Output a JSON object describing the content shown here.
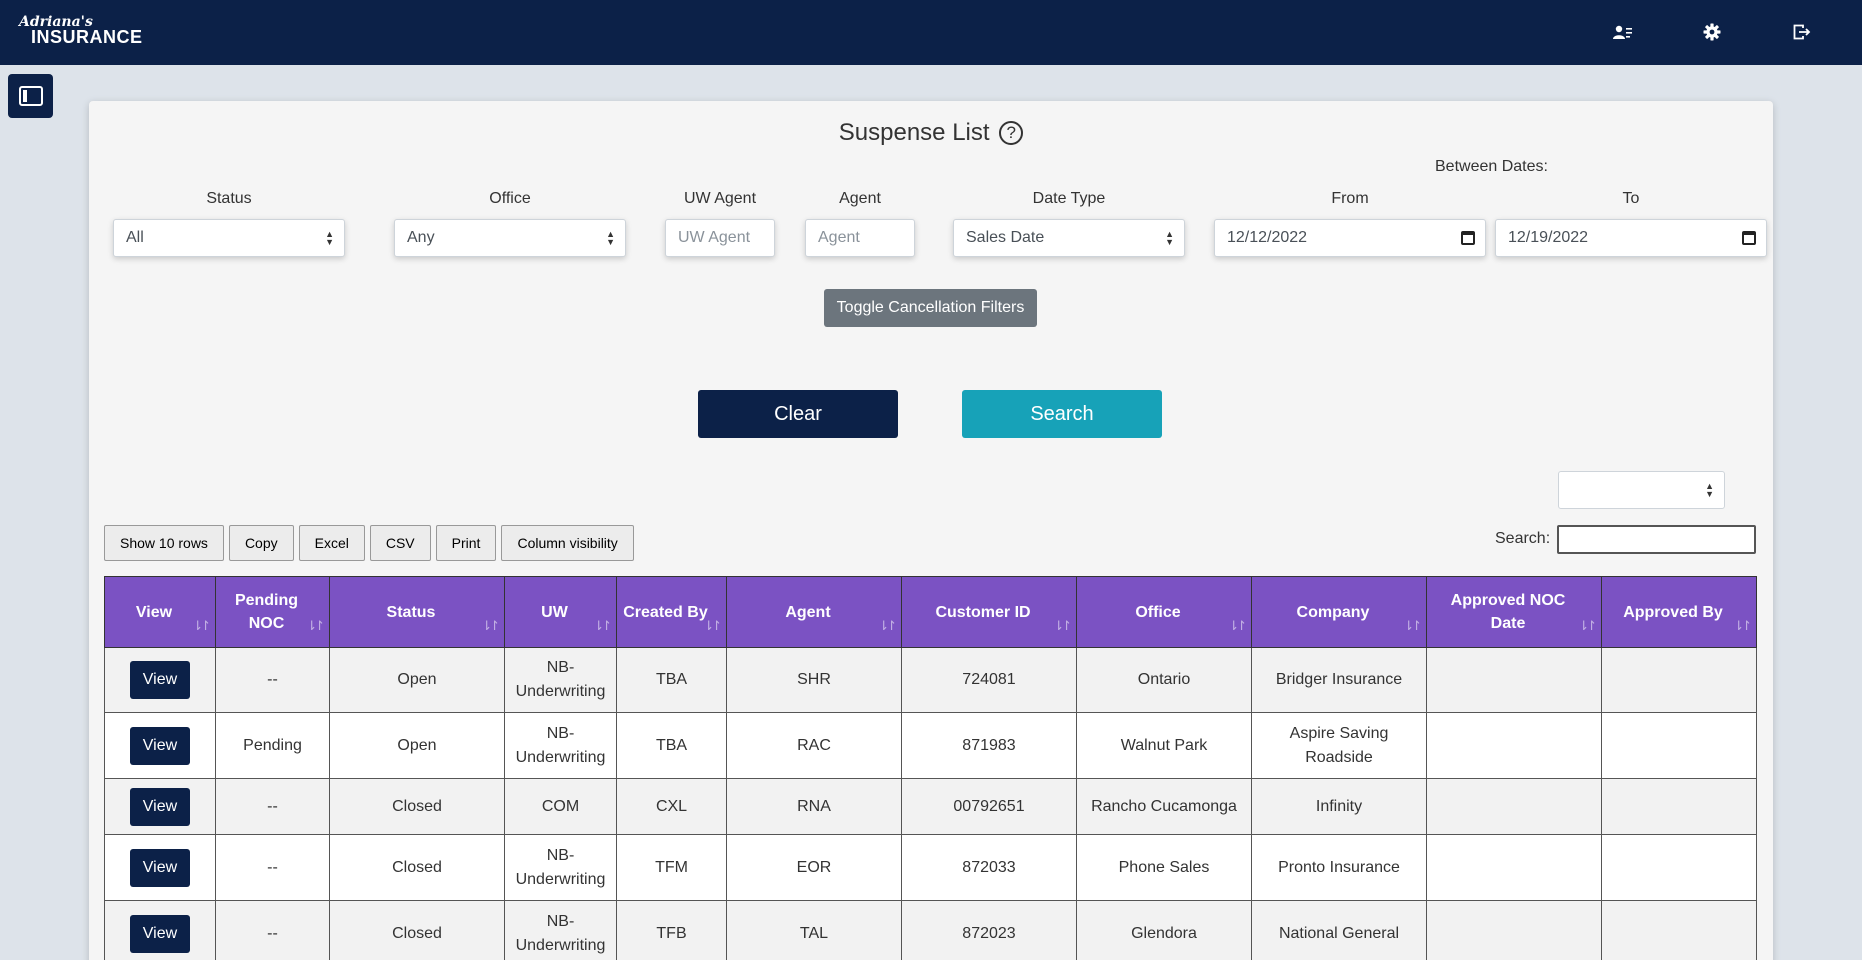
{
  "navbar": {
    "logo_script": "Adriana's",
    "logo_main": "INSURANCE",
    "icons": [
      "user-list-icon",
      "gear-icon",
      "logout-icon"
    ]
  },
  "page": {
    "title": "Suspense List",
    "help_glyph": "?",
    "between_dates_label": "Between Dates:"
  },
  "filters": {
    "status": {
      "label": "Status",
      "value": "All"
    },
    "office": {
      "label": "Office",
      "value": "Any"
    },
    "uw_agent": {
      "label": "UW Agent",
      "placeholder": "UW Agent"
    },
    "agent": {
      "label": "Agent",
      "placeholder": "Agent"
    },
    "date_type": {
      "label": "Date Type",
      "value": "Sales Date"
    },
    "from": {
      "label": "From",
      "value": "12/12/2022"
    },
    "to": {
      "label": "To",
      "value": "12/19/2022"
    }
  },
  "actions": {
    "toggle_label": "Toggle Cancellation Filters",
    "clear_label": "Clear",
    "search_label": "Search"
  },
  "datatable": {
    "buttons": [
      "Show 10 rows",
      "Copy",
      "Excel",
      "CSV",
      "Print",
      "Column visibility"
    ],
    "search_label": "Search:",
    "columns": [
      "View",
      "Pending NOC",
      "Status",
      "UW",
      "Created By",
      "Agent",
      "Customer ID",
      "Office",
      "Company",
      "Approved NOC Date",
      "Approved By"
    ],
    "rows": [
      {
        "view": "View",
        "pending": "--",
        "status": "Open",
        "uw": "NB-Underwriting",
        "created_by": "TBA",
        "agent": "SHR",
        "customer_id": "724081",
        "office": "Ontario",
        "company": "Bridger Insurance",
        "approved_date": "",
        "approved_by": ""
      },
      {
        "view": "View",
        "pending": "Pending",
        "status": "Open",
        "uw": "NB-Underwriting",
        "created_by": "TBA",
        "agent": "RAC",
        "customer_id": "871983",
        "office": "Walnut Park",
        "company": "Aspire Saving Roadside",
        "approved_date": "",
        "approved_by": ""
      },
      {
        "view": "View",
        "pending": "--",
        "status": "Closed",
        "uw": "COM",
        "created_by": "CXL",
        "agent": "RNA",
        "customer_id": "00792651",
        "office": "Rancho Cucamonga",
        "company": "Infinity",
        "approved_date": "",
        "approved_by": ""
      },
      {
        "view": "View",
        "pending": "--",
        "status": "Closed",
        "uw": "NB-Underwriting",
        "created_by": "TFM",
        "agent": "EOR",
        "customer_id": "872033",
        "office": "Phone Sales",
        "company": "Pronto Insurance",
        "approved_date": "",
        "approved_by": ""
      },
      {
        "view": "View",
        "pending": "--",
        "status": "Closed",
        "uw": "NB-Underwriting",
        "created_by": "TFB",
        "agent": "TAL",
        "customer_id": "872023",
        "office": "Glendora",
        "company": "National General",
        "approved_date": "",
        "approved_by": ""
      }
    ]
  },
  "colors": {
    "navy": "#0c2148",
    "teal": "#17a2b8",
    "purple_header": "#7b52c3",
    "gray_button": "#6c757d"
  }
}
